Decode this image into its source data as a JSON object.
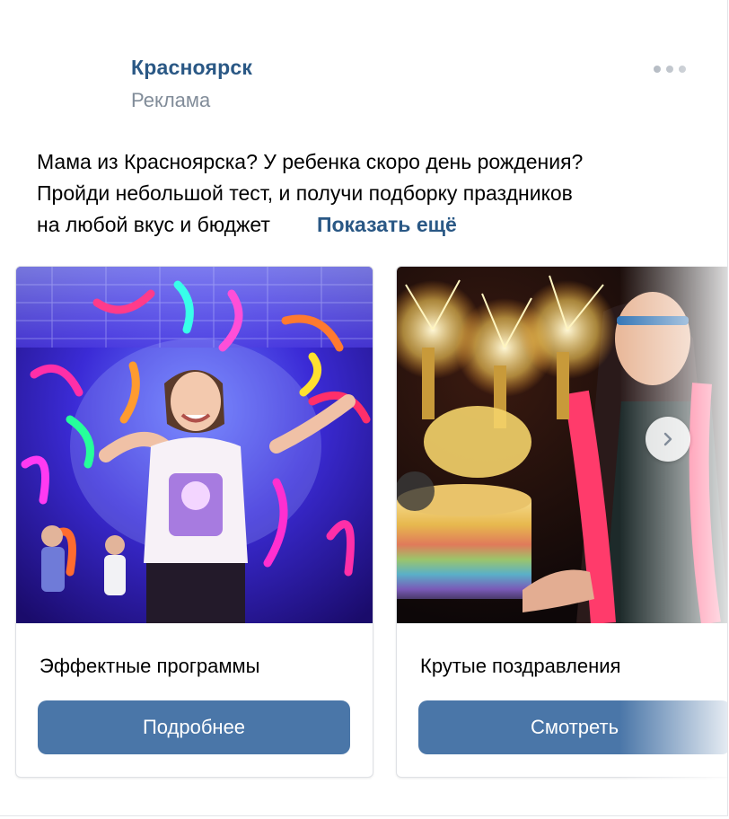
{
  "post": {
    "author": "Красноярск",
    "label": "Реклама",
    "text_lines": [
      "Мама из Красноярска? У ребенка скоро день рождения?",
      "Пройди небольшой тест, и получи подборку праздников",
      "на любой вкус и бюджет"
    ],
    "show_more": "Показать ещё"
  },
  "carousel": {
    "cards": [
      {
        "title": "Эффектные программы",
        "button": "Подробнее",
        "image_icon": "party-photo-girl-confetti"
      },
      {
        "title": "Крутые поздравления",
        "button": "Смотреть",
        "image_icon": "party-photo-cake-sparklers"
      }
    ]
  },
  "icons": {
    "more": "more-horizontal-icon",
    "next": "chevron-right-icon"
  },
  "colors": {
    "accent": "#2a5885",
    "button": "#4a76a8",
    "secondary_text": "#818c99"
  }
}
